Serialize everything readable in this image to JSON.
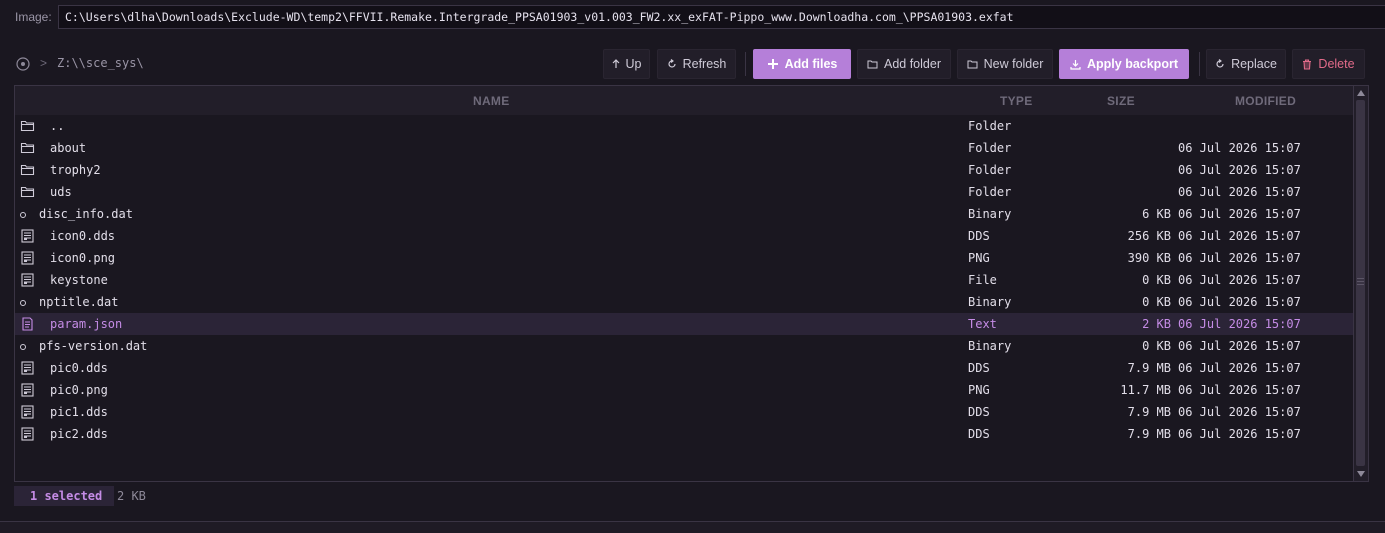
{
  "image_path": {
    "label": "Image:",
    "value": "C:\\Users\\dlha\\Downloads\\Exclude-WD\\temp2\\FFVII.Remake.Intergrade_PPSA01903_v01.003_FW2.xx_exFAT-Pippo_www.Downloadha.com_\\PPSA01903.exfat"
  },
  "breadcrumb": {
    "separator": ">",
    "path": "Z:\\\\sce_sys\\"
  },
  "toolbar": {
    "up": "Up",
    "refresh": "Refresh",
    "add_files": "Add files",
    "add_folder": "Add folder",
    "new_folder": "New folder",
    "apply_backport": "Apply backport",
    "replace": "Replace",
    "delete": "Delete"
  },
  "columns": {
    "name": "NAME",
    "type": "TYPE",
    "size": "SIZE",
    "modified": "MODIFIED"
  },
  "files": [
    {
      "name": "..",
      "type": "Folder",
      "size": "",
      "modified": "",
      "icon": "folder-icon"
    },
    {
      "name": "about",
      "type": "Folder",
      "size": "",
      "modified": "06 Jul 2026 15:07",
      "icon": "folder-icon"
    },
    {
      "name": "trophy2",
      "type": "Folder",
      "size": "",
      "modified": "06 Jul 2026 15:07",
      "icon": "folder-icon"
    },
    {
      "name": "uds",
      "type": "Folder",
      "size": "",
      "modified": "06 Jul 2026 15:07",
      "icon": "folder-icon"
    },
    {
      "name": "disc_info.dat",
      "type": "Binary",
      "size": "6 KB",
      "modified": "06 Jul 2026 15:07",
      "icon": "binary-dot-icon"
    },
    {
      "name": "icon0.dds",
      "type": "DDS",
      "size": "256 KB",
      "modified": "06 Jul 2026 15:07",
      "icon": "image-file-icon"
    },
    {
      "name": "icon0.png",
      "type": "PNG",
      "size": "390 KB",
      "modified": "06 Jul 2026 15:07",
      "icon": "image-file-icon"
    },
    {
      "name": "keystone",
      "type": "File",
      "size": "0 KB",
      "modified": "06 Jul 2026 15:07",
      "icon": "image-file-icon"
    },
    {
      "name": "nptitle.dat",
      "type": "Binary",
      "size": "0 KB",
      "modified": "06 Jul 2026 15:07",
      "icon": "binary-dot-icon"
    },
    {
      "name": "param.json",
      "type": "Text",
      "size": "2 KB",
      "modified": "06 Jul 2026 15:07",
      "icon": "text-file-icon",
      "selected": true
    },
    {
      "name": "pfs-version.dat",
      "type": "Binary",
      "size": "0 KB",
      "modified": "06 Jul 2026 15:07",
      "icon": "binary-dot-icon"
    },
    {
      "name": "pic0.dds",
      "type": "DDS",
      "size": "7.9 MB",
      "modified": "06 Jul 2026 15:07",
      "icon": "image-file-icon"
    },
    {
      "name": "pic0.png",
      "type": "PNG",
      "size": "11.7 MB",
      "modified": "06 Jul 2026 15:07",
      "icon": "image-file-icon"
    },
    {
      "name": "pic1.dds",
      "type": "DDS",
      "size": "7.9 MB",
      "modified": "06 Jul 2026 15:07",
      "icon": "image-file-icon"
    },
    {
      "name": "pic2.dds",
      "type": "DDS",
      "size": "7.9 MB",
      "modified": "06 Jul 2026 15:07",
      "icon": "image-file-icon"
    }
  ],
  "status": {
    "selected": "1 selected",
    "size": "2 KB"
  },
  "colors": {
    "accent": "#b57fd9",
    "selected_text": "#c58ce6",
    "delete": "#e26b8a",
    "background": "#1a1720"
  }
}
